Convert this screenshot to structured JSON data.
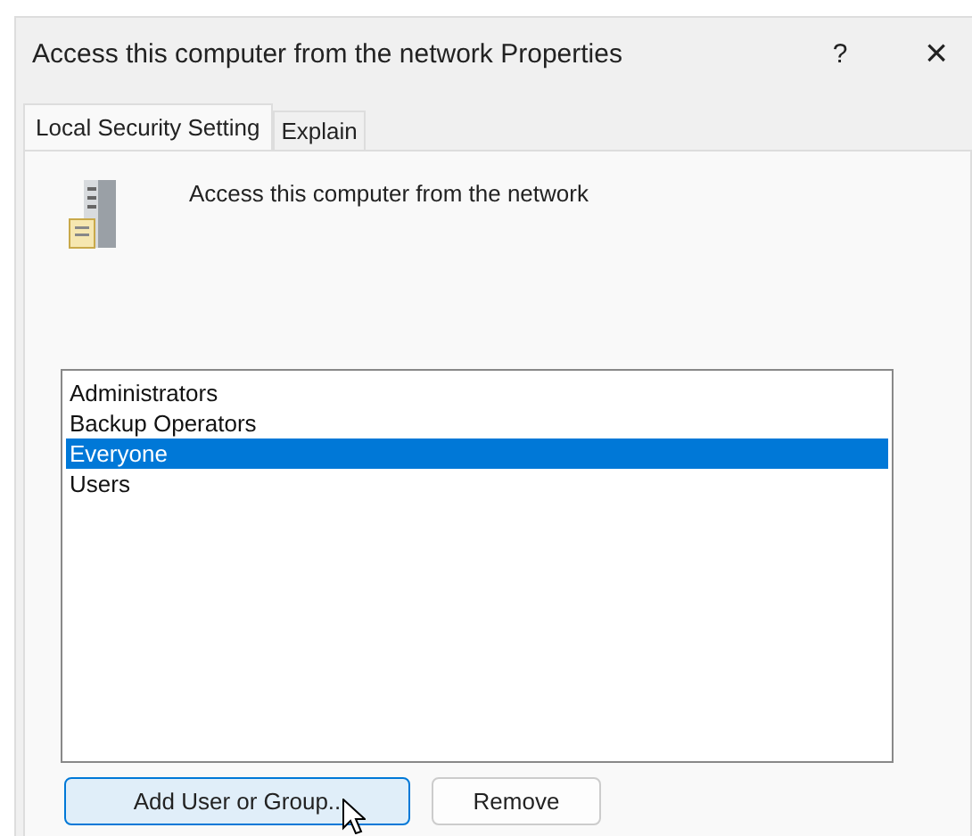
{
  "window": {
    "title": "Access this computer from the network Properties",
    "help": "?",
    "close": "×"
  },
  "tabs": [
    {
      "label": "Local Security Setting",
      "selected": true
    },
    {
      "label": "Explain",
      "selected": false
    }
  ],
  "policy": {
    "name": "Access this computer from the network"
  },
  "accounts": [
    {
      "name": "Administrators",
      "selected": false
    },
    {
      "name": "Backup Operators",
      "selected": false
    },
    {
      "name": "Everyone",
      "selected": true
    },
    {
      "name": "Users",
      "selected": false
    }
  ],
  "buttons": [
    {
      "label": "Add User or Group..",
      "hovered": true
    },
    {
      "label": "Remove",
      "hovered": false
    }
  ]
}
